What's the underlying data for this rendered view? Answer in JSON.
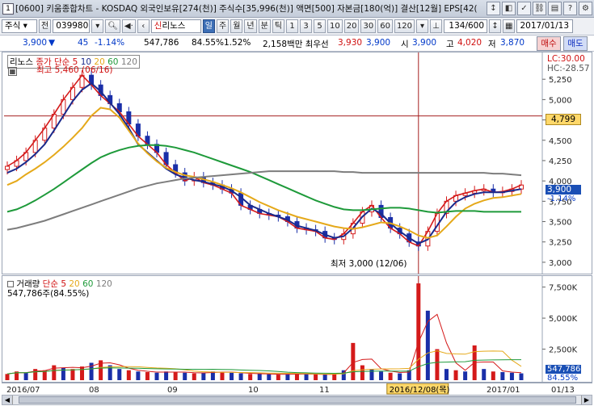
{
  "titlebar": {
    "app_icon": "1",
    "title": "[0600] 키움종합차트 - KOSDAQ 외국인보유[274(천)] 주식수[35,996(천)] 액면[500] 자본금[180(억)] 결산[12월] EPS[42(",
    "buttons": [
      "↕",
      "◧",
      "✓",
      "⛓",
      "▤",
      "?",
      "⚙"
    ]
  },
  "toolbar": {
    "type_select": "주식",
    "scope": "전",
    "code": "039980",
    "search_icon": "magnifier-icon",
    "stock_badge": "신",
    "stock_name": "리노스",
    "periods": [
      "일",
      "주",
      "월",
      "년",
      "분",
      "틱"
    ],
    "active_period": "일",
    "intervals": [
      "1",
      "3",
      "5",
      "10",
      "20",
      "30",
      "60",
      "120"
    ],
    "count": "134/600",
    "date": "2017/01/13"
  },
  "quote": {
    "price": "3,900",
    "change_arrow": "▼",
    "change": "45",
    "change_pct": "-1.14%",
    "volume": "547,786",
    "turnover_pct": "84.55%",
    "ratio": "1.52%",
    "amount_label": "2,158백만 최우선",
    "best_ask": "3,930",
    "best_bid": "3,900",
    "open_label": "시",
    "open": "3,900",
    "high_label": "고",
    "high": "4,020",
    "low_label": "저",
    "low": "3,870",
    "buy_label": "매수",
    "sell_label": "매도"
  },
  "price_pane": {
    "legend_name": "리노스",
    "legend_ma_label": "종가 단순",
    "legend_periods": [
      "5",
      "10",
      "20",
      "60",
      "120"
    ],
    "high_note": "최고 5,460 (06/16)",
    "low_note": "최저 3,000 (12/06)",
    "lc_label": "LC:30.00",
    "hc_label": "HC:-28.57",
    "ref_price": "4,799",
    "last_price": "3,900",
    "last_change": "-1.14%"
  },
  "volume_pane": {
    "legend_name": "거래량",
    "legend_ma_label": "단순",
    "legend_periods": [
      "5",
      "20",
      "60",
      "120"
    ],
    "volume_text": "547,786주(84.55%)",
    "last_volume": "547,786",
    "last_pct": "84.55%"
  },
  "date_axis": {
    "labels": [
      "2016/07",
      "08",
      "09",
      "10",
      "11",
      "12",
      "2017/01",
      "01/13"
    ],
    "crosshair_date": "2016/12/08(목)"
  },
  "colors": {
    "up": "#d41a1a",
    "down": "#1a2fa8",
    "ma5": "#d41a1a",
    "ma10": "#1a2a8c",
    "ma20": "#e5a91a",
    "ma60": "#1e9a3a",
    "ma120": "#7d7d7d",
    "crosshair": "#a52020"
  },
  "chart_data": {
    "type": "line",
    "title": "리노스",
    "y_price_ticks": [
      5250,
      5000,
      4750,
      4500,
      4250,
      4000,
      3750,
      3500,
      3250,
      3000
    ],
    "y_price_tick_labels": [
      "5,250",
      "5,000",
      "4,750",
      "4,500",
      "4,250",
      "4,000",
      "3,750",
      "3,500",
      "3,250",
      "3,000"
    ],
    "y_volume_ticks": [
      7500,
      5000,
      2500
    ],
    "y_volume_tick_labels": [
      "7,500K",
      "5,000K",
      "2,500K"
    ],
    "x_labels": [
      "2016/07",
      "08",
      "09",
      "10",
      "11",
      "12",
      "2017/01",
      "01/13"
    ],
    "series": [
      {
        "name": "5",
        "values": [
          4180,
          4250,
          4350,
          4500,
          4650,
          4820,
          5000,
          5150,
          5300,
          5180,
          5050,
          4950,
          4850,
          4700,
          4550,
          4450,
          4350,
          4200,
          4100,
          4000,
          4050,
          3980,
          3950,
          3900,
          3850,
          3700,
          3650,
          3600,
          3580,
          3560,
          3500,
          3420,
          3400,
          3380,
          3300,
          3280,
          3350,
          3480,
          3620,
          3700,
          3550,
          3420,
          3350,
          3250,
          3200,
          3380,
          3600,
          3750,
          3820,
          3850,
          3880,
          3900,
          3860,
          3870,
          3900,
          3950
        ]
      },
      {
        "name": "10",
        "values": [
          4100,
          4150,
          4230,
          4330,
          4450,
          4620,
          4800,
          4980,
          5120,
          5200,
          5100,
          4960,
          4820,
          4650,
          4450,
          4350,
          4250,
          4150,
          4080,
          4040,
          4010,
          3990,
          3960,
          3930,
          3880,
          3800,
          3700,
          3650,
          3600,
          3560,
          3520,
          3450,
          3420,
          3390,
          3340,
          3300,
          3320,
          3420,
          3560,
          3660,
          3600,
          3480,
          3380,
          3300,
          3230,
          3280,
          3450,
          3620,
          3740,
          3800,
          3840,
          3860,
          3860,
          3860,
          3880,
          3900
        ]
      },
      {
        "name": "20",
        "values": [
          3950,
          4000,
          4080,
          4150,
          4230,
          4320,
          4420,
          4530,
          4650,
          4800,
          4900,
          4880,
          4780,
          4620,
          4460,
          4340,
          4240,
          4160,
          4110,
          4070,
          4050,
          4020,
          3990,
          3950,
          3910,
          3860,
          3800,
          3740,
          3690,
          3640,
          3600,
          3560,
          3530,
          3500,
          3470,
          3440,
          3420,
          3410,
          3430,
          3460,
          3490,
          3480,
          3440,
          3390,
          3330,
          3300,
          3330,
          3440,
          3560,
          3660,
          3720,
          3760,
          3790,
          3800,
          3820,
          3840
        ]
      },
      {
        "name": "60",
        "values": [
          3620,
          3650,
          3700,
          3760,
          3830,
          3900,
          3980,
          4060,
          4140,
          4220,
          4290,
          4340,
          4380,
          4410,
          4430,
          4440,
          4440,
          4430,
          4410,
          4380,
          4350,
          4310,
          4270,
          4230,
          4190,
          4150,
          4110,
          4060,
          4010,
          3960,
          3910,
          3860,
          3810,
          3760,
          3720,
          3680,
          3650,
          3640,
          3640,
          3650,
          3660,
          3670,
          3670,
          3660,
          3640,
          3620,
          3610,
          3620,
          3630,
          3630,
          3630,
          3620,
          3620,
          3620,
          3620,
          3620
        ]
      },
      {
        "name": "120",
        "values": [
          3400,
          3420,
          3450,
          3480,
          3510,
          3550,
          3590,
          3630,
          3670,
          3710,
          3750,
          3790,
          3830,
          3870,
          3910,
          3940,
          3970,
          3990,
          4010,
          4030,
          4040,
          4050,
          4060,
          4070,
          4080,
          4090,
          4100,
          4110,
          4120,
          4120,
          4120,
          4120,
          4120,
          4120,
          4120,
          4120,
          4110,
          4110,
          4100,
          4100,
          4100,
          4100,
          4100,
          4100,
          4100,
          4100,
          4100,
          4100,
          4100,
          4100,
          4100,
          4100,
          4090,
          4090,
          4080,
          4070
        ]
      }
    ],
    "ylim": [
      2900,
      5500
    ],
    "volume_ylim": [
      0,
      8000
    ],
    "volume_bars": [
      500,
      700,
      600,
      900,
      800,
      1200,
      1000,
      900,
      1100,
      1400,
      1600,
      1200,
      900,
      800,
      700,
      650,
      600,
      700,
      650,
      600,
      550,
      600,
      700,
      650,
      600,
      550,
      500,
      520,
      480,
      450,
      500,
      520,
      480,
      460,
      450,
      500,
      800,
      3000,
      1200,
      900,
      700,
      600,
      550,
      800,
      7800,
      5600,
      2500,
      900,
      800,
      700,
      2800,
      900,
      700,
      650,
      600,
      548
    ],
    "volume_up": [
      true,
      true,
      false,
      true,
      true,
      true,
      false,
      true,
      true,
      false,
      true,
      false,
      false,
      true,
      false,
      true,
      false,
      false,
      true,
      false,
      true,
      false,
      false,
      true,
      false,
      false,
      true,
      false,
      false,
      true,
      false,
      true,
      false,
      true,
      false,
      true,
      false,
      true,
      true,
      false,
      false,
      true,
      false,
      false,
      true,
      false,
      true,
      false,
      true,
      false,
      true,
      false,
      true,
      false,
      false,
      false
    ]
  }
}
